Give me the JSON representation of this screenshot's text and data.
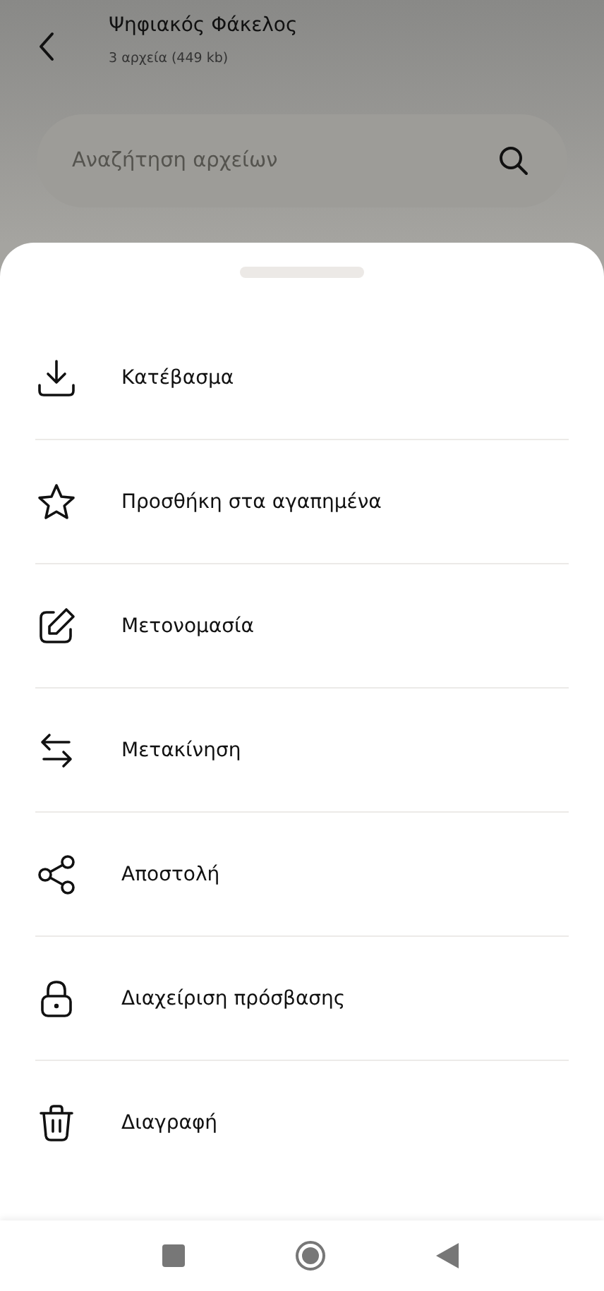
{
  "header": {
    "title": "Ψηφιακός Φάκελος",
    "subtitle": "3 αρχεία (449 kb)"
  },
  "search": {
    "placeholder": "Αναζήτηση αρχείων"
  },
  "actions": [
    {
      "kind": "download",
      "label": "Κατέβασμα"
    },
    {
      "kind": "favorite",
      "label": "Προσθήκη στα αγαπημένα"
    },
    {
      "kind": "rename",
      "label": "Μετονομασία"
    },
    {
      "kind": "move",
      "label": "Μετακίνηση"
    },
    {
      "kind": "share",
      "label": "Αποστολή"
    },
    {
      "kind": "access",
      "label": "Διαχείριση πρόσβασης"
    },
    {
      "kind": "delete",
      "label": "Διαγραφή"
    }
  ]
}
